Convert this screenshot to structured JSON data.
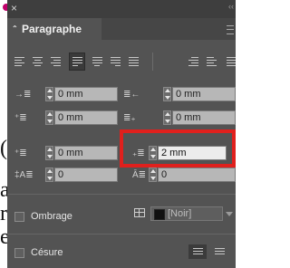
{
  "window": {
    "close_glyph": "×",
    "collapse_glyph": "‹‹"
  },
  "panel": {
    "title": "Paragraphe",
    "tab_chevron": "⌃"
  },
  "alignment": [
    "align-left",
    "align-center",
    "align-right",
    "justify-left",
    "justify-center",
    "justify-right",
    "justify-all",
    "align-towards-spine",
    "align-away-from-spine"
  ],
  "fields": {
    "left_indent": "0 mm",
    "right_indent": "0 mm",
    "first_line_indent": "0 mm",
    "last_line_indent": "0 mm",
    "space_before": "0 mm",
    "space_after": "2 mm",
    "drop_cap_lines": "0",
    "drop_cap_chars": "0"
  },
  "shading": {
    "label": "Ombrage",
    "swatch_label": "[Noir]",
    "swatch_color": "#111111"
  },
  "hyphenation": {
    "label": "Césure"
  },
  "background_text": [
    "(",
    "a",
    "ri",
    "e"
  ],
  "colors": {
    "panel": "#535353",
    "highlight": "#e0201d",
    "accent_dot": "#c0006b"
  }
}
